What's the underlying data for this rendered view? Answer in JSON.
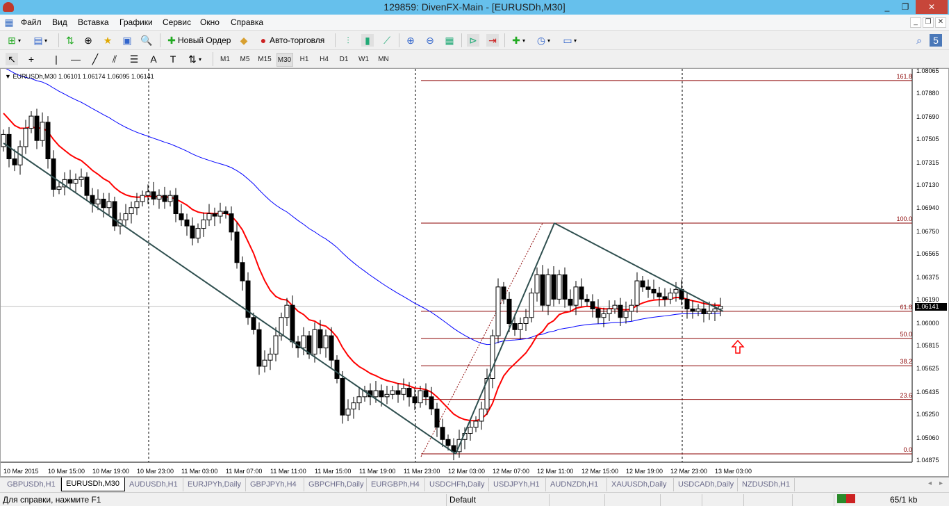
{
  "window": {
    "title": "129859: DivenFX-Main - [EURUSDh,M30]",
    "minimize": "_",
    "maximize": "❐",
    "close": "✕"
  },
  "menu": {
    "items": [
      "Файл",
      "Вид",
      "Вставка",
      "Графики",
      "Сервис",
      "Окно",
      "Справка"
    ]
  },
  "toolbar": {
    "new_order": "Новый Ордер",
    "auto_trading": "Авто-торговля",
    "search_placeholder": ""
  },
  "timeframes": [
    "M1",
    "M5",
    "M15",
    "M30",
    "H1",
    "H4",
    "D1",
    "W1",
    "MN"
  ],
  "active_timeframe": "M30",
  "chart": {
    "symbol_info": "EURUSDh,M30  1.06101 1.06174 1.06095 1.06141",
    "current_price": "1.06141",
    "price_axis": [
      "1.08065",
      "1.07880",
      "1.07690",
      "1.07505",
      "1.07315",
      "1.07130",
      "1.06940",
      "1.06750",
      "1.06565",
      "1.06375",
      "1.06190",
      "1.06000",
      "1.05815",
      "1.05625",
      "1.05435",
      "1.05250",
      "1.05060",
      "1.04875"
    ],
    "time_axis": [
      "10 Mar 2015",
      "10 Mar 15:00",
      "10 Mar 19:00",
      "10 Mar 23:00",
      "11 Mar 03:00",
      "11 Mar 07:00",
      "11 Mar 11:00",
      "11 Mar 15:00",
      "11 Mar 19:00",
      "11 Mar 23:00",
      "12 Mar 03:00",
      "12 Mar 07:00",
      "12 Mar 11:00",
      "12 Mar 15:00",
      "12 Mar 19:00",
      "12 Mar 23:00",
      "13 Mar 03:00"
    ],
    "fibonacci": {
      "price_0": 1.04932,
      "price_100": 1.06823,
      "levels": [
        "0.0",
        "23.6",
        "38.2",
        "50.0",
        "61.8",
        "100.0",
        "161.8"
      ],
      "color": "#8b0000"
    },
    "colors": {
      "fast_ma": "#ff0000",
      "slow_ma": "#0000ff",
      "trendline": "#2f4f4f",
      "bull_body": "#ffffff",
      "bear_body": "#000000",
      "arrow": "#ff0000"
    },
    "closes": [
      1.0755,
      1.0735,
      1.073,
      1.0745,
      1.076,
      1.077,
      1.075,
      1.0765,
      1.0735,
      1.071,
      1.0712,
      1.0718,
      1.0715,
      1.0718,
      1.072,
      1.0705,
      1.0698,
      1.0702,
      1.0695,
      1.07,
      1.068,
      1.0685,
      1.069,
      1.0695,
      1.07,
      1.0705,
      1.0708,
      1.0702,
      1.0705,
      1.07,
      1.0705,
      1.069,
      1.0685,
      1.068,
      1.067,
      1.0678,
      1.0685,
      1.069,
      1.0688,
      1.0692,
      1.069,
      1.0675,
      1.065,
      1.0635,
      1.0605,
      1.0595,
      1.0565,
      1.057,
      1.0575,
      1.059,
      1.0605,
      1.0615,
      1.0585,
      1.058,
      1.059,
      1.0575,
      1.0595,
      1.058,
      1.059,
      1.057,
      1.0555,
      1.0525,
      1.053,
      1.0535,
      1.054,
      1.0545,
      1.054,
      1.0545,
      1.054,
      1.0542,
      1.0545,
      1.0542,
      1.0547,
      1.054,
      1.0535,
      1.0545,
      1.054,
      1.053,
      1.0515,
      1.0505,
      1.05,
      1.0495,
      1.0505,
      1.051,
      1.0515,
      1.052,
      1.053,
      1.0555,
      1.059,
      1.063,
      1.062,
      1.06,
      1.0595,
      1.06,
      1.0605,
      1.0625,
      1.064,
      1.0615,
      1.064,
      1.062,
      1.064,
      1.062,
      1.0615,
      1.063,
      1.062,
      1.0618,
      1.0612,
      1.0605,
      1.0608,
      1.0612,
      1.0615,
      1.0605,
      1.061,
      1.0615,
      1.0635,
      1.063,
      1.0628,
      1.0625,
      1.0622,
      1.062,
      1.0625,
      1.0628,
      1.062,
      1.0612,
      1.061,
      1.0612,
      1.0608,
      1.061,
      1.0612,
      1.06141
    ]
  },
  "tabs": [
    "GBPUSDh,H1",
    "EURUSDh,M30",
    "AUDUSDh,H1",
    "EURJPYh,Daily",
    "GBPJPYh,H4",
    "GBPCHFh,Daily",
    "EURGBPh,H4",
    "USDCHFh,Daily",
    "USDJPYh,H1",
    "AUDNZDh,H1",
    "XAUUSDh,Daily",
    "USDCADh,Daily",
    "NZDUSDh,H1"
  ],
  "active_tab": "EURUSDh,M30",
  "status": {
    "help": "Для справки, нажмите F1",
    "profile": "Default",
    "traffic": "65/1 kb"
  }
}
